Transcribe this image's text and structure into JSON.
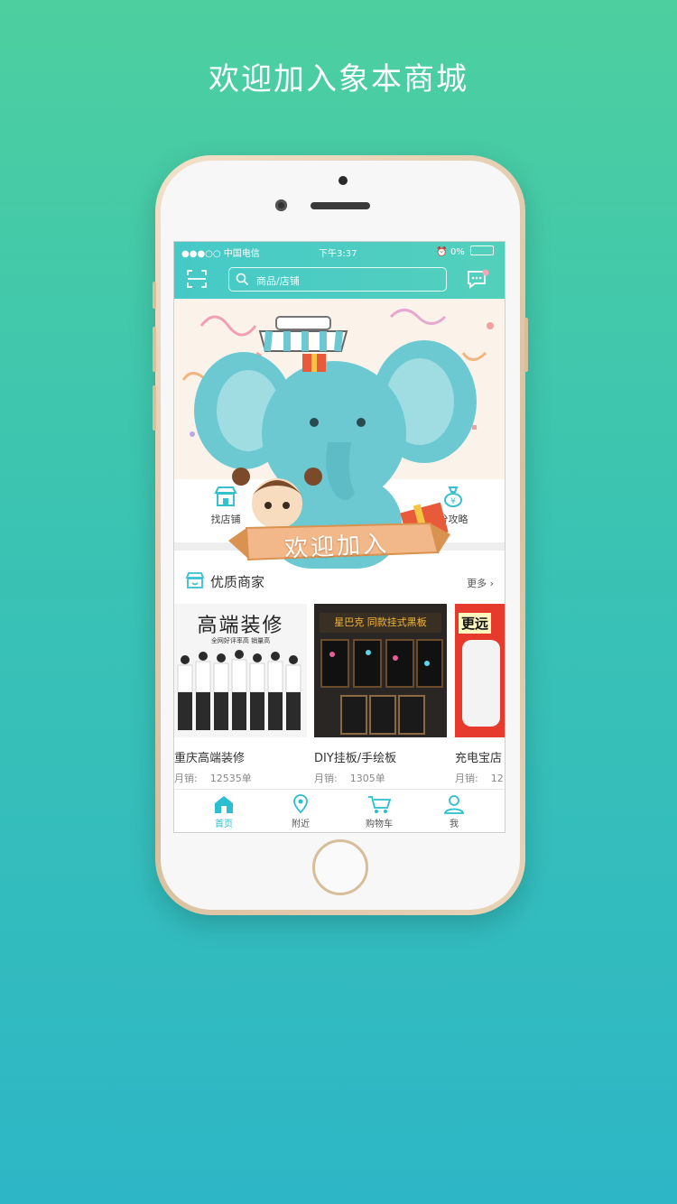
{
  "headline": "欢迎加入象本商城",
  "status": {
    "carrier": "●●●○○ 中国电信",
    "time": "下午3:37",
    "battery": "0%"
  },
  "search": {
    "placeholder": "商品/店铺"
  },
  "quick": [
    {
      "label": "找店铺",
      "icon": "store-icon"
    },
    {
      "label": "分攻略",
      "icon": "money-bag-icon"
    }
  ],
  "section": {
    "title": "优质商家",
    "more": "更多"
  },
  "cards": [
    {
      "image_text": "高端装修",
      "image_sub": "全网好评率高 销量高",
      "title": "重庆高端装修",
      "sales_label": "月销:",
      "sales_value": "12535单"
    },
    {
      "image_text": "星巴克 同款挂式黑板",
      "title": "DIY挂板/手绘板",
      "sales_label": "月销:",
      "sales_value": "1305单"
    },
    {
      "image_text": "更远",
      "title": "充电宝店",
      "sales_label": "月销:",
      "sales_value": "12"
    }
  ],
  "welcome_ribbon": "欢迎加入",
  "tabs": [
    {
      "label": "首页",
      "icon": "home-icon",
      "active": true
    },
    {
      "label": "附近",
      "icon": "location-icon"
    },
    {
      "label": "购物车",
      "icon": "cart-icon"
    },
    {
      "label": "我",
      "icon": "user-icon"
    }
  ],
  "colors": {
    "accent": "#2bbfd1",
    "header": "#4ccbc3",
    "elephant": "#6cc9d2"
  }
}
